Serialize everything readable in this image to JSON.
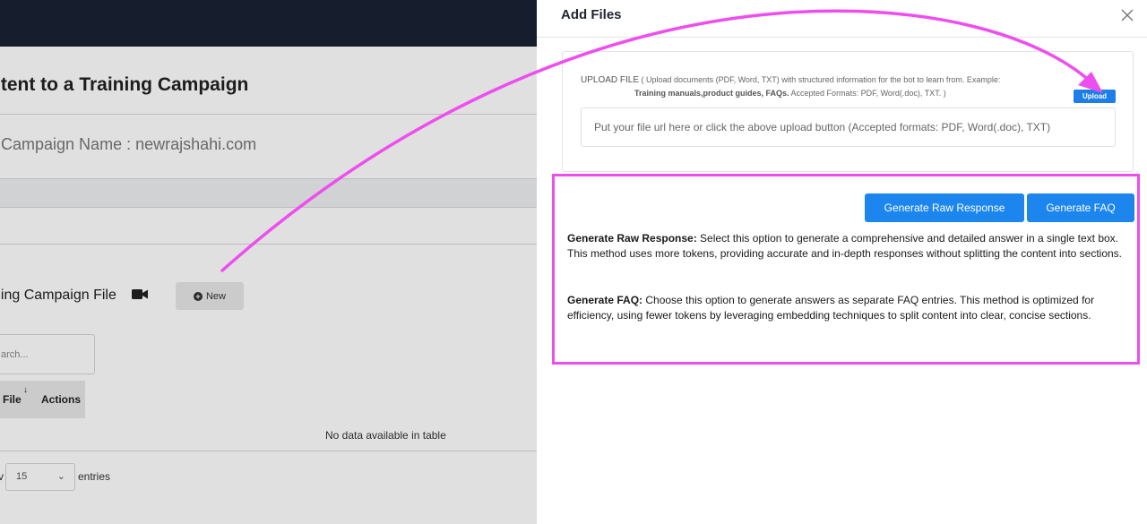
{
  "background": {
    "page_heading": "ntent to a Training Campaign",
    "campaign_name": "g Campaign Name : newrajshahi.com",
    "file_section_label": "ning Campaign File",
    "new_button": "New",
    "search_placeholder": "arch...",
    "table_headers": {
      "file": "File",
      "actions": "Actions"
    },
    "empty_message": "No data available in table",
    "show_prefix": "v",
    "entries_value": "15",
    "entries_suffix": "entries"
  },
  "panel": {
    "title": "Add Files",
    "upload": {
      "label": "UPLOAD FILE",
      "hint_start": " ( Upload documents (PDF, Word, TXT) with structured information for the bot to learn from. Example: ",
      "hint_bold": "Training manuals,product guides, FAQs.",
      "hint_end": " Accepted Formats: PDF, Word(.doc), TXT. )",
      "button": "Upload",
      "url_placeholder": "Put your file url here or click the above upload button (Accepted formats: PDF, Word(.doc), TXT)"
    },
    "actions": {
      "raw_button": "Generate Raw Response",
      "faq_button": "Generate FAQ"
    },
    "descriptions": {
      "raw_title": "Generate Raw Response:",
      "raw_text": " Select this option to generate a comprehensive and detailed answer in a single text box. This method uses more tokens, providing accurate and in-depth responses without splitting the content into sections.",
      "faq_title": "Generate FAQ:",
      "faq_text": " Choose this option to generate answers as separate FAQ entries. This method is optimized for efficiency, using fewer tokens by leveraging embedding techniques to split content into clear, concise sections."
    }
  },
  "colors": {
    "accent": "#1c86ee",
    "annotation": "#ee4eee",
    "topbar": "#1a2233"
  },
  "icons": {
    "close": "close-icon",
    "camera": "video-camera-icon",
    "plus": "plus-circle-icon",
    "sort": "sort-down-icon",
    "chevron": "chevron-down-icon"
  }
}
